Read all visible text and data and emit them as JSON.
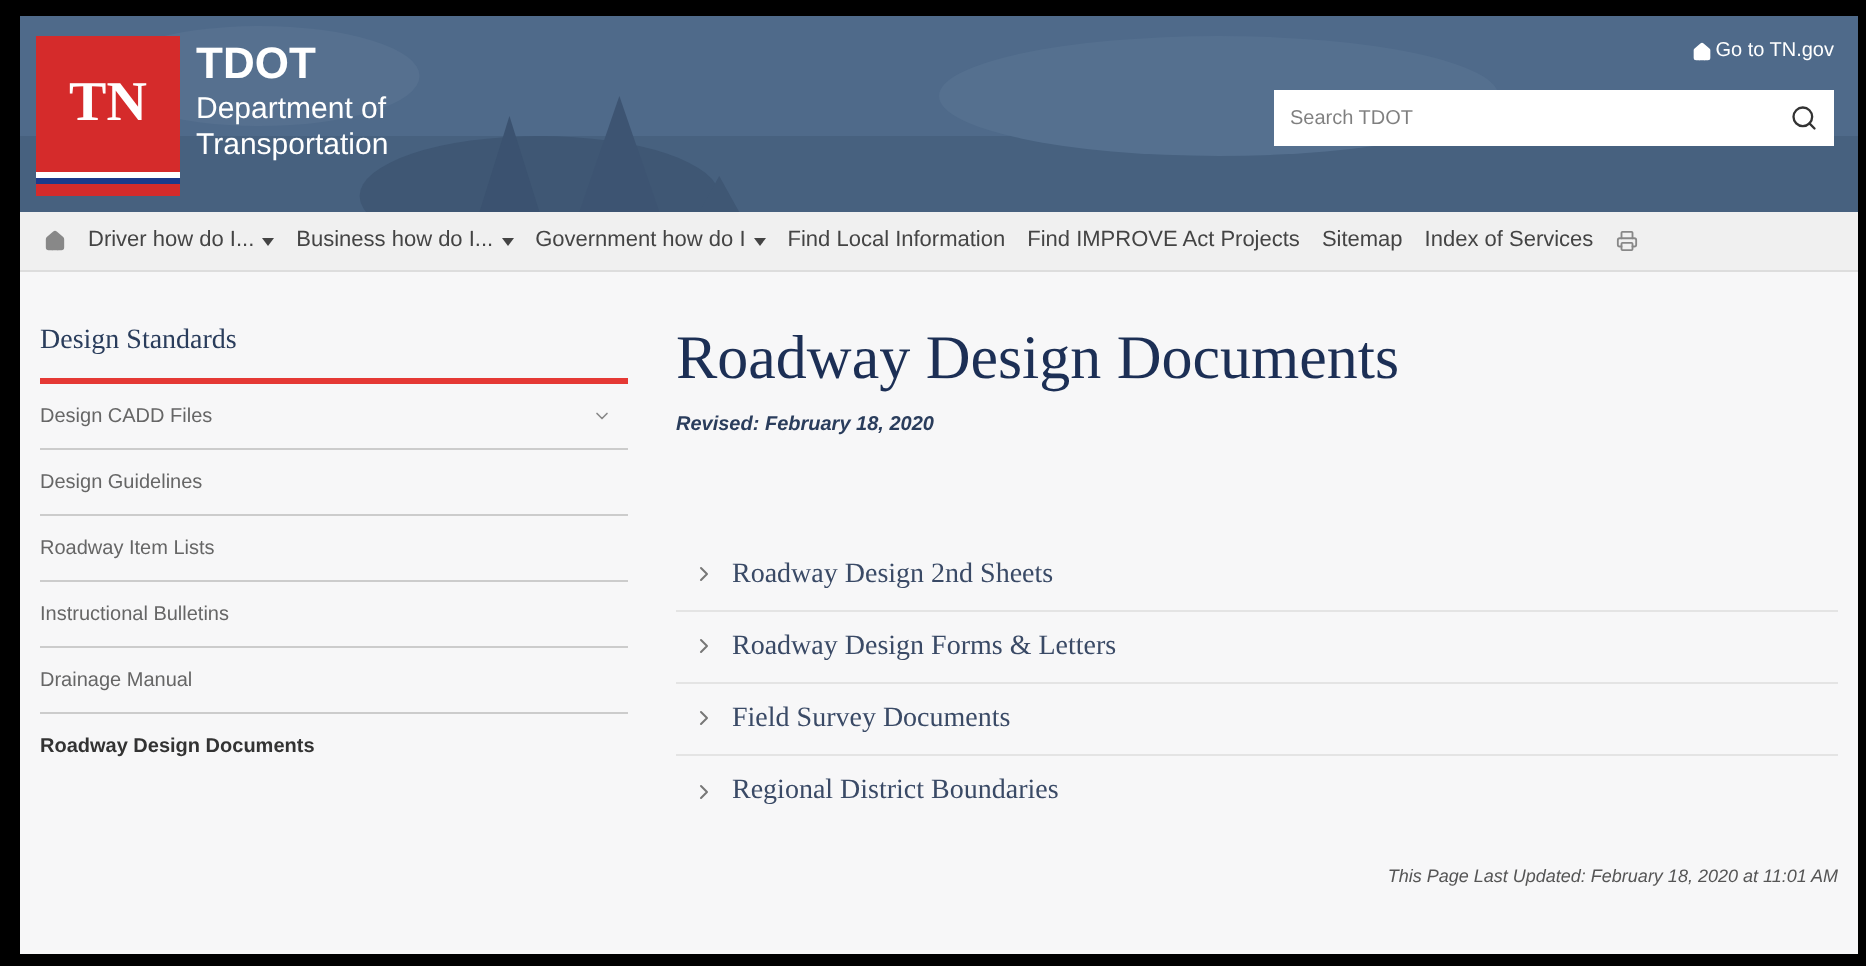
{
  "header": {
    "logo_mark": "TN",
    "logo_title": "TDOT",
    "logo_subtitle_1": "Department of",
    "logo_subtitle_2": "Transportation",
    "top_link": "Go to TN.gov",
    "search": {
      "placeholder": "Search TDOT"
    }
  },
  "nav": [
    {
      "label": "Driver how do I...",
      "has_menu": true
    },
    {
      "label": "Business how do I...",
      "has_menu": true
    },
    {
      "label": "Government how do I",
      "has_menu": true
    },
    {
      "label": "Find Local Information",
      "has_menu": false
    },
    {
      "label": "Find IMPROVE Act Projects",
      "has_menu": false
    },
    {
      "label": "Sitemap",
      "has_menu": false
    },
    {
      "label": "Index of Services",
      "has_menu": false
    }
  ],
  "sidebar": {
    "title": "Design Standards",
    "items": [
      {
        "label": "Design CADD Files",
        "selected": false,
        "expandable": true
      },
      {
        "label": "Design Guidelines",
        "selected": false,
        "expandable": false
      },
      {
        "label": "Roadway Item Lists",
        "selected": false,
        "expandable": false
      },
      {
        "label": "Instructional Bulletins",
        "selected": false,
        "expandable": false
      },
      {
        "label": "Drainage Manual",
        "selected": false,
        "expandable": false
      },
      {
        "label": "Roadway Design Documents",
        "selected": true,
        "expandable": false
      }
    ]
  },
  "main": {
    "title": "Roadway Design Documents",
    "revised": "Revised: February 18, 2020",
    "sections": [
      {
        "label": "Roadway Design 2nd Sheets",
        "expanded": false
      },
      {
        "label": "Roadway Design Forms & Letters",
        "expanded": false
      },
      {
        "label": "Field Survey Documents",
        "expanded": false
      },
      {
        "label": "Regional District Boundaries",
        "expanded": false
      }
    ],
    "last_updated": "This Page Last Updated: February 18, 2020 at 11:01 AM"
  }
}
